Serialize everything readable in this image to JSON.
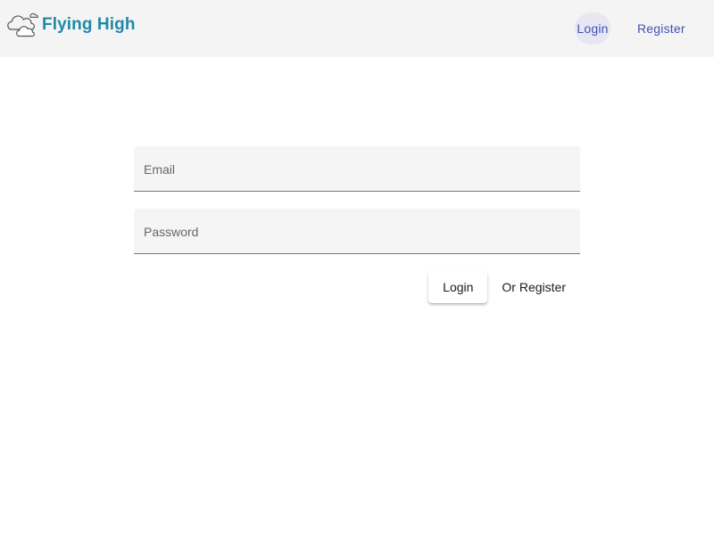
{
  "header": {
    "brand": "Flying High",
    "logo_icon": "cloud-icon",
    "nav": {
      "login_label": "Login",
      "register_label": "Register"
    }
  },
  "login_form": {
    "email": {
      "placeholder": "Email",
      "value": ""
    },
    "password": {
      "placeholder": "Password",
      "value": ""
    },
    "login_button_label": "Login",
    "register_button_label": "Or Register"
  },
  "colors": {
    "accent": "#3f51b5",
    "brand": "#1f8aa6",
    "toolbar_bg": "#f4f4f4"
  }
}
